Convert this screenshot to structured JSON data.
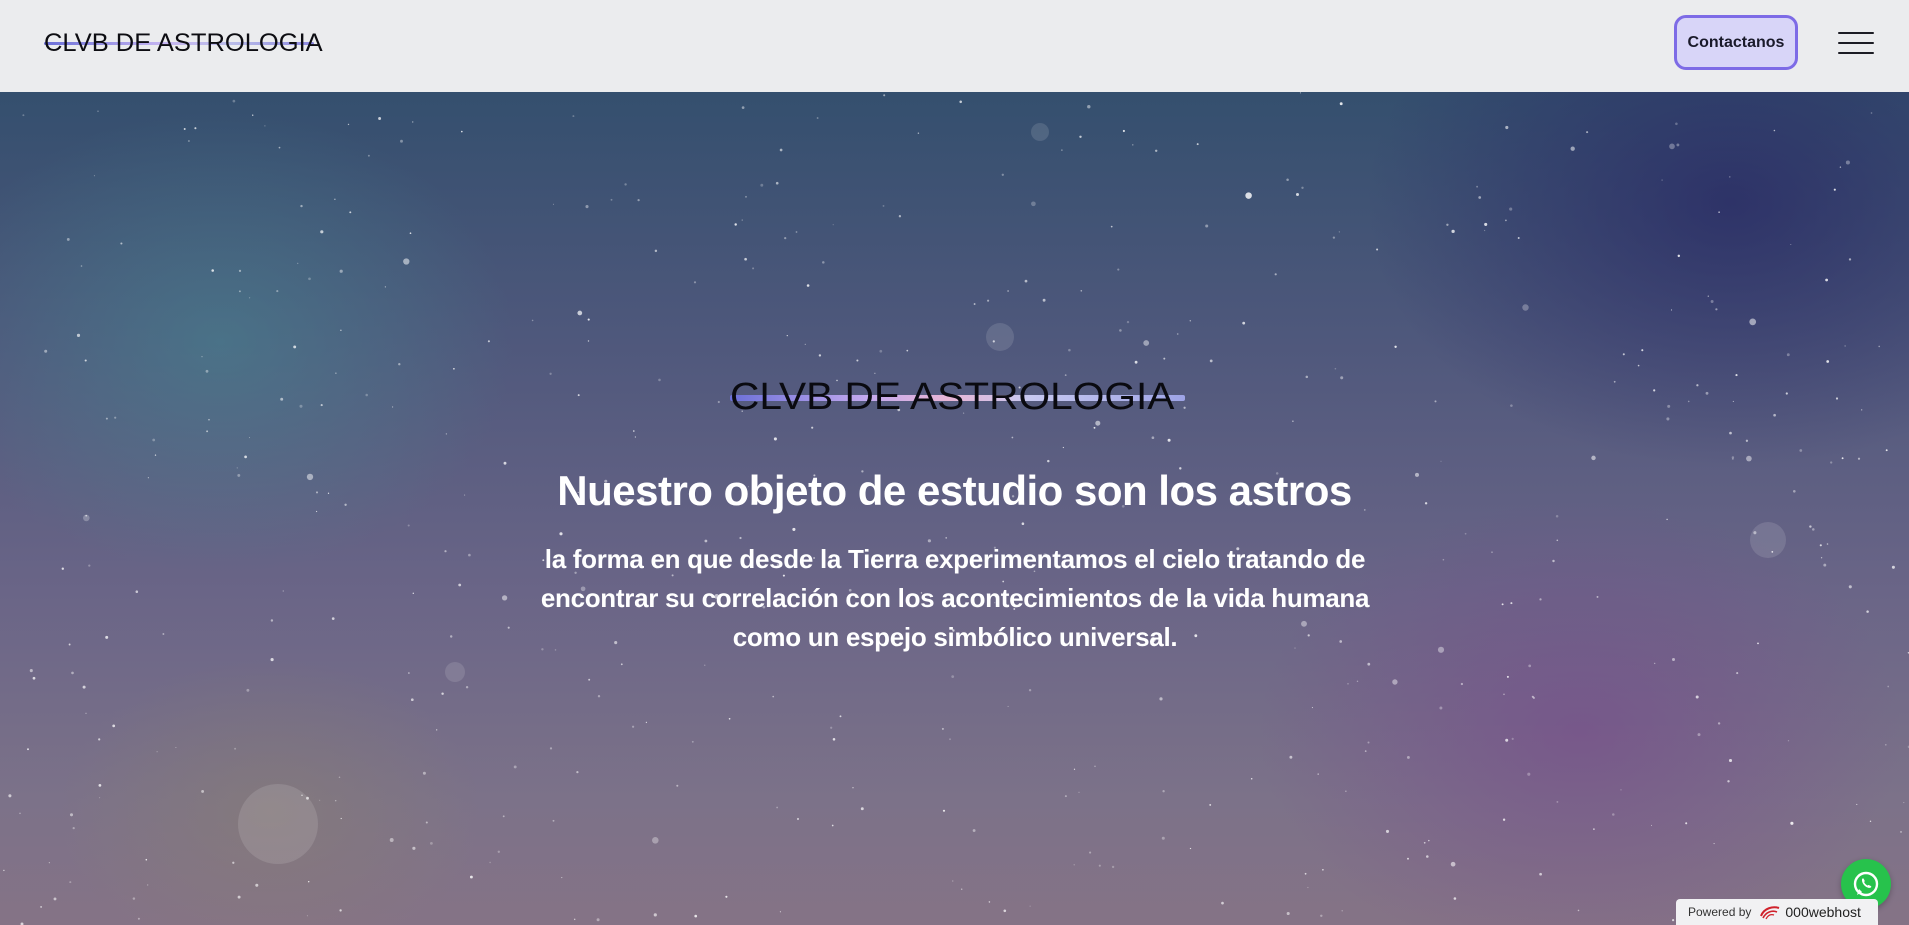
{
  "header": {
    "logo_text": "CLVB DE ASTROLOGIA",
    "contact_label": "Contactanos",
    "menu_icon": "hamburger-menu-icon"
  },
  "hero": {
    "logo_text": "CLVB DE ASTROLOGIA",
    "headline": "Nuestro objeto de estudio son los astros",
    "subtext": "la forma en que desde la Tierra experimentamos el cielo tratando de encontrar su correlación con los acontecimientos de la vida humana como un espejo simbólico universal."
  },
  "widgets": {
    "whatsapp_icon": "whatsapp-icon",
    "powered_label": "Powered by",
    "powered_brand": "000webhost",
    "powered_icon": "000webhost-logo-icon"
  },
  "colors": {
    "header_bg": "#ebecee",
    "accent_purple": "#7d6be6",
    "contact_bg": "#d8d5f8",
    "whatsapp_green": "#27c24c"
  }
}
